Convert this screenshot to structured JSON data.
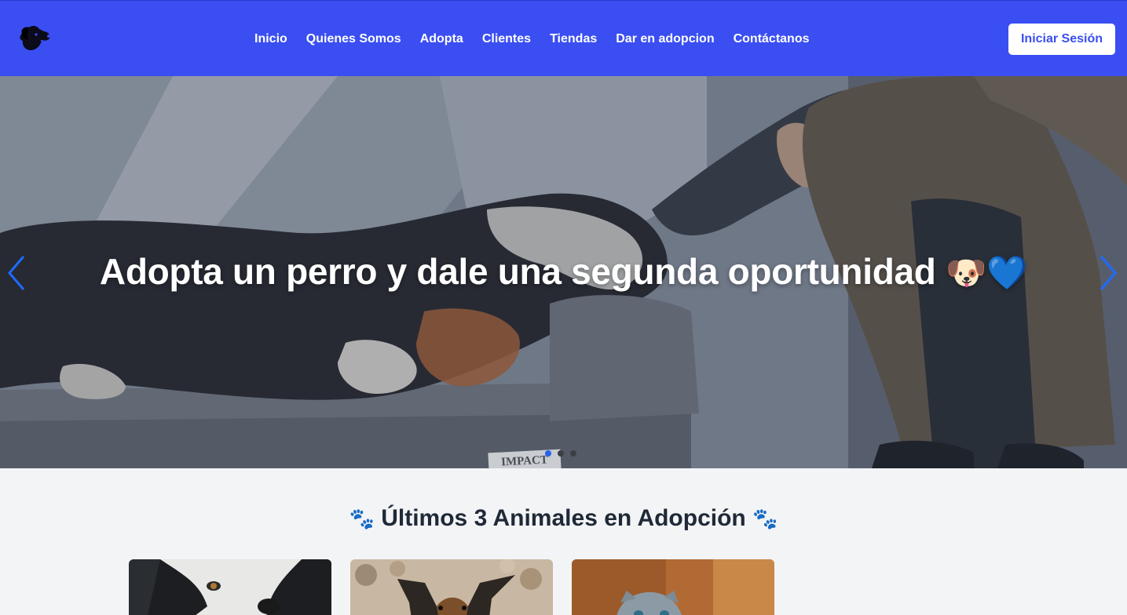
{
  "header": {
    "logo_icon": "dog-head-icon",
    "nav": [
      {
        "label": "Inicio"
      },
      {
        "label": "Quienes Somos"
      },
      {
        "label": "Adopta"
      },
      {
        "label": "Clientes"
      },
      {
        "label": "Tiendas"
      },
      {
        "label": "Dar en adopcion"
      },
      {
        "label": "Contáctanos"
      }
    ],
    "login_label": "Iniciar Sesión",
    "accent_color": "#3a4ef2"
  },
  "hero": {
    "title": "Adopta un perro y dale una segunda oportunidad",
    "title_emoji": "🐶💙",
    "photo_tag": "IMPACT",
    "prev_icon": "chevron-left-icon",
    "next_icon": "chevron-right-icon",
    "slides": 3,
    "active_slide": 1
  },
  "section": {
    "title": "Últimos 3 Animales en Adopción",
    "paw_icon": "🐾"
  },
  "cards": [
    {
      "animal": "husky-dog-photo"
    },
    {
      "animal": "shepherd-puppy-photo"
    },
    {
      "animal": "gray-cat-photo"
    }
  ]
}
